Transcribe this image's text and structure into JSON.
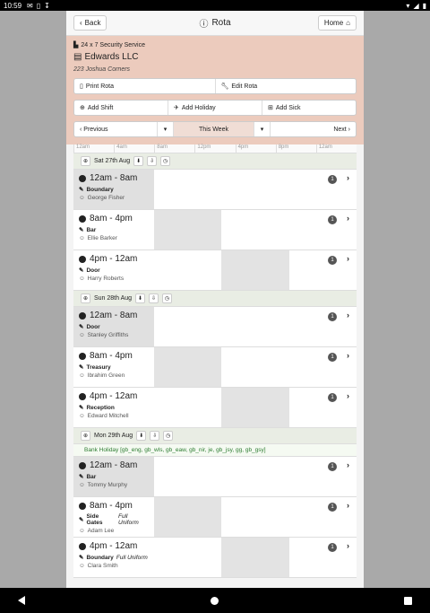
{
  "status": {
    "time": "10:59"
  },
  "topbar": {
    "back_label": "Back",
    "title": "Rota",
    "home_label": "Home"
  },
  "header": {
    "service": "24 x 7 Security Service",
    "company": "Edwards LLC",
    "address": "223 Joshua Corners"
  },
  "actions": {
    "print": "Print Rota",
    "edit": "Edit Rota",
    "add_shift": "Add Shift",
    "add_holiday": "Add Holiday",
    "add_sick": "Add Sick"
  },
  "weeknav": {
    "prev": "Previous",
    "current": "This Week",
    "next": "Next"
  },
  "timeline": [
    "12am",
    "4am",
    "8am",
    "12pm",
    "4pm",
    "8pm",
    "12am"
  ],
  "days": [
    {
      "label": "Sat 27th Aug",
      "holiday": "",
      "shifts": [
        {
          "time": "12am - 8am",
          "location": "Boundary",
          "note": "",
          "person": "George Fisher",
          "count": "1"
        },
        {
          "time": "8am - 4pm",
          "location": "Bar",
          "note": "",
          "person": "Ellie Barker",
          "count": "1"
        },
        {
          "time": "4pm - 12am",
          "location": "Door",
          "note": "",
          "person": "Harry Roberts",
          "count": "1"
        }
      ]
    },
    {
      "label": "Sun 28th Aug",
      "holiday": "",
      "shifts": [
        {
          "time": "12am - 8am",
          "location": "Door",
          "note": "",
          "person": "Stanley Griffiths",
          "count": "1"
        },
        {
          "time": "8am - 4pm",
          "location": "Treasury",
          "note": "",
          "person": "Ibrahim Green",
          "count": "1"
        },
        {
          "time": "4pm - 12am",
          "location": "Reception",
          "note": "",
          "person": "Edward Mitchell",
          "count": "1"
        }
      ]
    },
    {
      "label": "Mon 29th Aug",
      "holiday": "Bank Holiday [gb_eng, gb_wls, gb_eaw, gb_nir, je, gb_jsy, gg, gb_gsy]",
      "shifts": [
        {
          "time": "12am - 8am",
          "location": "Bar",
          "note": "",
          "person": "Tommy Murphy",
          "count": "1"
        },
        {
          "time": "8am - 4pm",
          "location": "Side Gates",
          "note": "Full Uniform",
          "person": "Adam Lee",
          "count": "1"
        },
        {
          "time": "4pm - 12am",
          "location": "Boundary",
          "note": "Full Uniform",
          "person": "Clara Smith",
          "count": "1"
        }
      ]
    }
  ]
}
